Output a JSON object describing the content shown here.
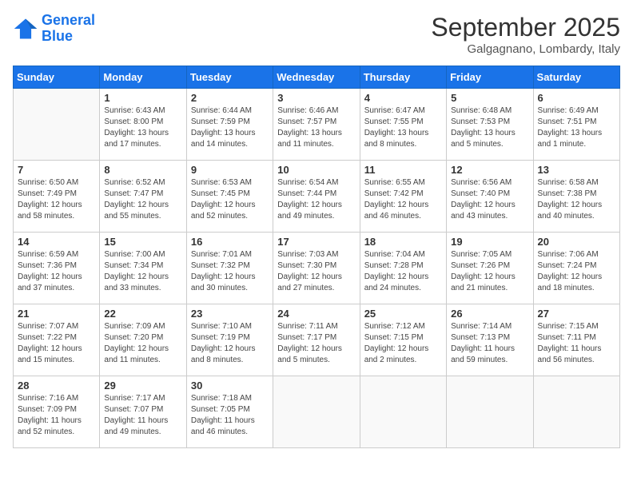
{
  "logo": {
    "line1": "General",
    "line2": "Blue"
  },
  "title": "September 2025",
  "subtitle": "Galgagnano, Lombardy, Italy",
  "days_of_week": [
    "Sunday",
    "Monday",
    "Tuesday",
    "Wednesday",
    "Thursday",
    "Friday",
    "Saturday"
  ],
  "weeks": [
    [
      {
        "day": "",
        "info": ""
      },
      {
        "day": "1",
        "info": "Sunrise: 6:43 AM\nSunset: 8:00 PM\nDaylight: 13 hours\nand 17 minutes."
      },
      {
        "day": "2",
        "info": "Sunrise: 6:44 AM\nSunset: 7:59 PM\nDaylight: 13 hours\nand 14 minutes."
      },
      {
        "day": "3",
        "info": "Sunrise: 6:46 AM\nSunset: 7:57 PM\nDaylight: 13 hours\nand 11 minutes."
      },
      {
        "day": "4",
        "info": "Sunrise: 6:47 AM\nSunset: 7:55 PM\nDaylight: 13 hours\nand 8 minutes."
      },
      {
        "day": "5",
        "info": "Sunrise: 6:48 AM\nSunset: 7:53 PM\nDaylight: 13 hours\nand 5 minutes."
      },
      {
        "day": "6",
        "info": "Sunrise: 6:49 AM\nSunset: 7:51 PM\nDaylight: 13 hours\nand 1 minute."
      }
    ],
    [
      {
        "day": "7",
        "info": "Sunrise: 6:50 AM\nSunset: 7:49 PM\nDaylight: 12 hours\nand 58 minutes."
      },
      {
        "day": "8",
        "info": "Sunrise: 6:52 AM\nSunset: 7:47 PM\nDaylight: 12 hours\nand 55 minutes."
      },
      {
        "day": "9",
        "info": "Sunrise: 6:53 AM\nSunset: 7:45 PM\nDaylight: 12 hours\nand 52 minutes."
      },
      {
        "day": "10",
        "info": "Sunrise: 6:54 AM\nSunset: 7:44 PM\nDaylight: 12 hours\nand 49 minutes."
      },
      {
        "day": "11",
        "info": "Sunrise: 6:55 AM\nSunset: 7:42 PM\nDaylight: 12 hours\nand 46 minutes."
      },
      {
        "day": "12",
        "info": "Sunrise: 6:56 AM\nSunset: 7:40 PM\nDaylight: 12 hours\nand 43 minutes."
      },
      {
        "day": "13",
        "info": "Sunrise: 6:58 AM\nSunset: 7:38 PM\nDaylight: 12 hours\nand 40 minutes."
      }
    ],
    [
      {
        "day": "14",
        "info": "Sunrise: 6:59 AM\nSunset: 7:36 PM\nDaylight: 12 hours\nand 37 minutes."
      },
      {
        "day": "15",
        "info": "Sunrise: 7:00 AM\nSunset: 7:34 PM\nDaylight: 12 hours\nand 33 minutes."
      },
      {
        "day": "16",
        "info": "Sunrise: 7:01 AM\nSunset: 7:32 PM\nDaylight: 12 hours\nand 30 minutes."
      },
      {
        "day": "17",
        "info": "Sunrise: 7:03 AM\nSunset: 7:30 PM\nDaylight: 12 hours\nand 27 minutes."
      },
      {
        "day": "18",
        "info": "Sunrise: 7:04 AM\nSunset: 7:28 PM\nDaylight: 12 hours\nand 24 minutes."
      },
      {
        "day": "19",
        "info": "Sunrise: 7:05 AM\nSunset: 7:26 PM\nDaylight: 12 hours\nand 21 minutes."
      },
      {
        "day": "20",
        "info": "Sunrise: 7:06 AM\nSunset: 7:24 PM\nDaylight: 12 hours\nand 18 minutes."
      }
    ],
    [
      {
        "day": "21",
        "info": "Sunrise: 7:07 AM\nSunset: 7:22 PM\nDaylight: 12 hours\nand 15 minutes."
      },
      {
        "day": "22",
        "info": "Sunrise: 7:09 AM\nSunset: 7:20 PM\nDaylight: 12 hours\nand 11 minutes."
      },
      {
        "day": "23",
        "info": "Sunrise: 7:10 AM\nSunset: 7:19 PM\nDaylight: 12 hours\nand 8 minutes."
      },
      {
        "day": "24",
        "info": "Sunrise: 7:11 AM\nSunset: 7:17 PM\nDaylight: 12 hours\nand 5 minutes."
      },
      {
        "day": "25",
        "info": "Sunrise: 7:12 AM\nSunset: 7:15 PM\nDaylight: 12 hours\nand 2 minutes."
      },
      {
        "day": "26",
        "info": "Sunrise: 7:14 AM\nSunset: 7:13 PM\nDaylight: 11 hours\nand 59 minutes."
      },
      {
        "day": "27",
        "info": "Sunrise: 7:15 AM\nSunset: 7:11 PM\nDaylight: 11 hours\nand 56 minutes."
      }
    ],
    [
      {
        "day": "28",
        "info": "Sunrise: 7:16 AM\nSunset: 7:09 PM\nDaylight: 11 hours\nand 52 minutes."
      },
      {
        "day": "29",
        "info": "Sunrise: 7:17 AM\nSunset: 7:07 PM\nDaylight: 11 hours\nand 49 minutes."
      },
      {
        "day": "30",
        "info": "Sunrise: 7:18 AM\nSunset: 7:05 PM\nDaylight: 11 hours\nand 46 minutes."
      },
      {
        "day": "",
        "info": ""
      },
      {
        "day": "",
        "info": ""
      },
      {
        "day": "",
        "info": ""
      },
      {
        "day": "",
        "info": ""
      }
    ]
  ]
}
